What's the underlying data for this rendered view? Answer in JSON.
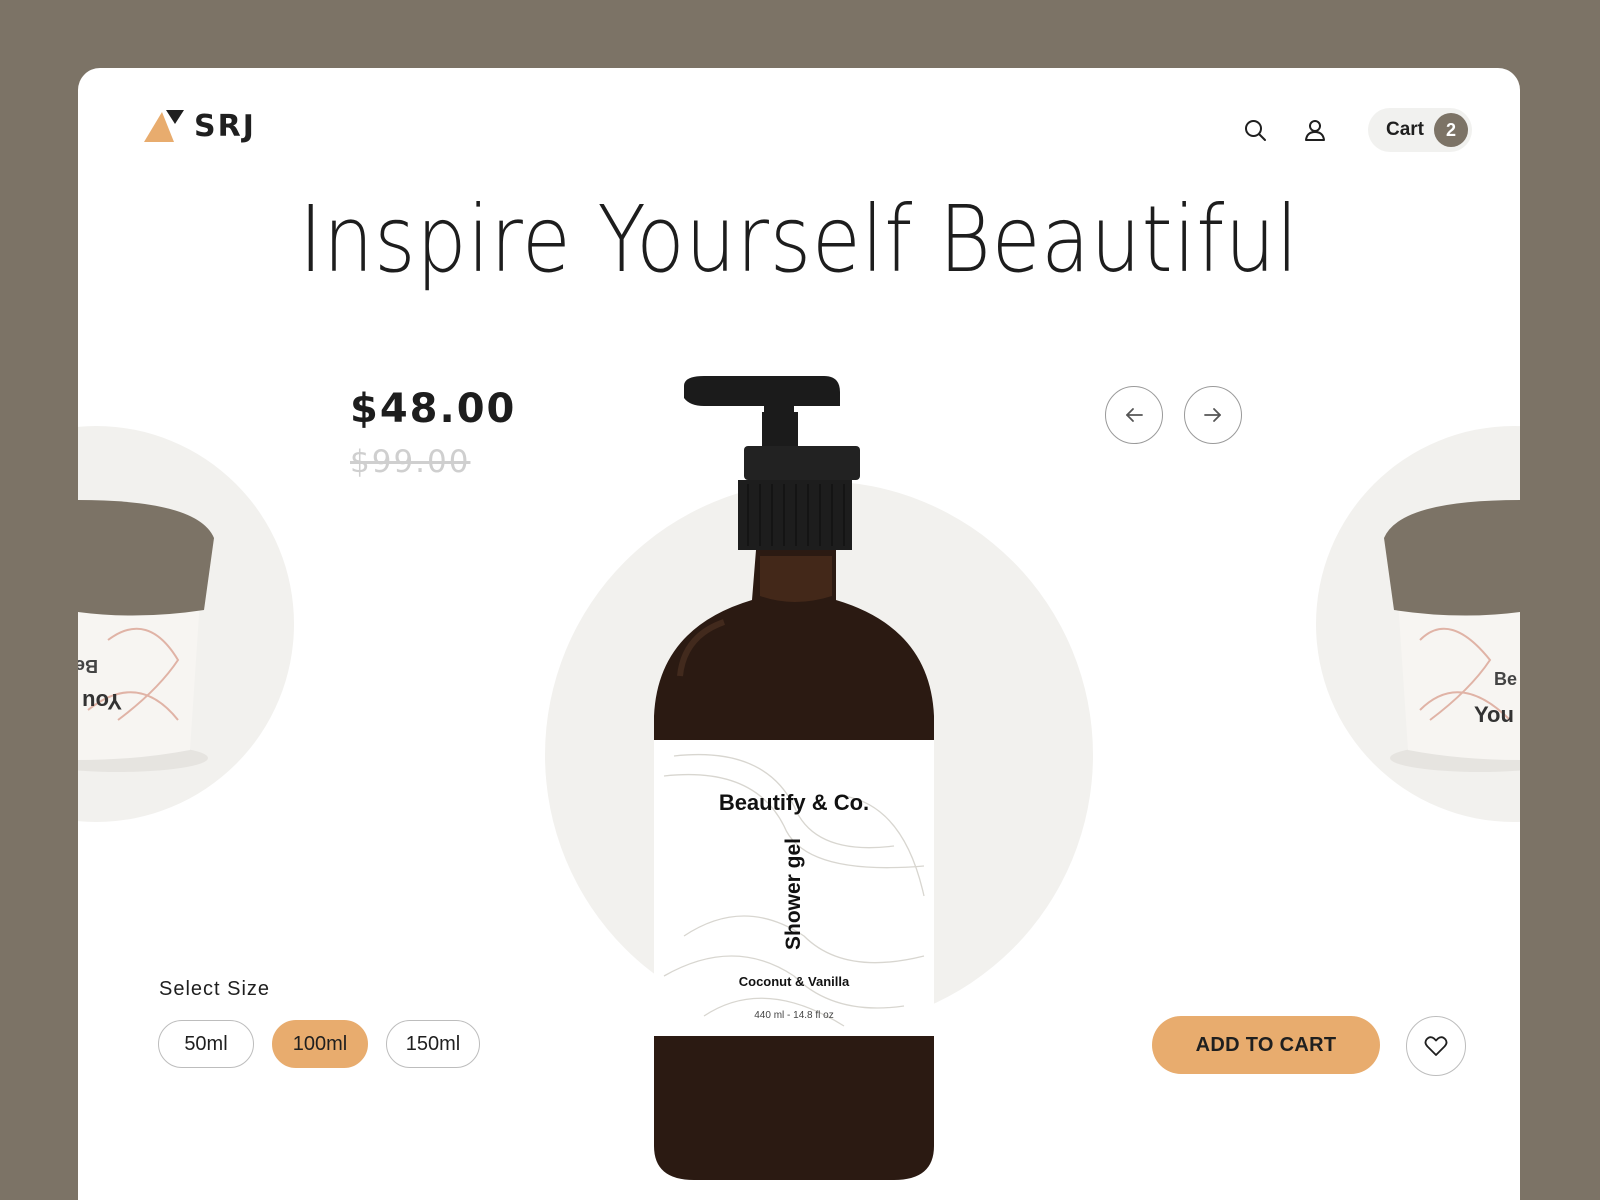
{
  "brand": {
    "name": "SRJ"
  },
  "header": {
    "cart_label": "Cart",
    "cart_count": "2",
    "icons": [
      "search-icon",
      "user-icon"
    ]
  },
  "hero": {
    "headline": "Inspire Yourself Beautiful"
  },
  "product": {
    "price": "$48.00",
    "original_price": "$99.00",
    "label": {
      "brand": "Beautify & Co.",
      "type": "Shower gel",
      "scent": "Coconut & Vanilla",
      "volume": "440 ml - 14.8 fl oz"
    }
  },
  "side_products": {
    "left_text_1": "Be",
    "left_text_2": "You",
    "right_text_1": "Be",
    "right_text_2": "You"
  },
  "size": {
    "label": "Select Size",
    "options": [
      "50ml",
      "100ml",
      "150ml"
    ],
    "selected": "100ml"
  },
  "actions": {
    "add_to_cart": "ADD TO CART"
  },
  "colors": {
    "background": "#7c7366",
    "accent": "#e8ac6e",
    "circle": "#f2f1ee",
    "text": "#1d1d1d"
  }
}
